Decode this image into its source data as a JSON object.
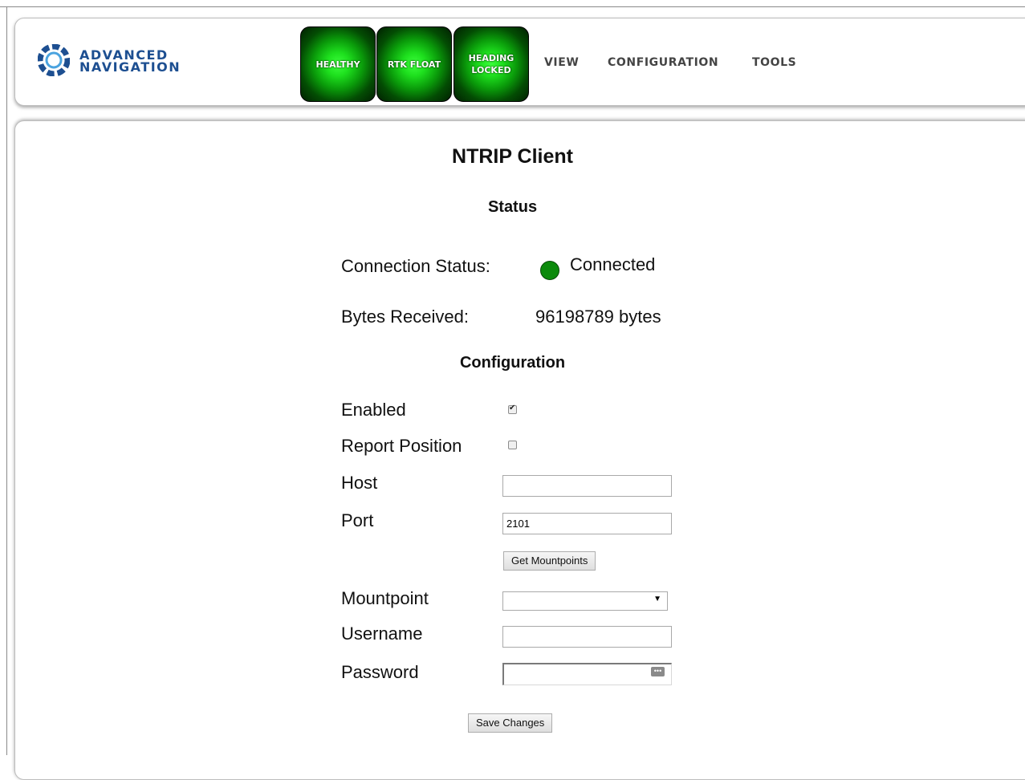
{
  "brand": {
    "line1": "ADVANCED",
    "line2": "NAVIGATION"
  },
  "status_indicators": [
    {
      "line1": "HEALTHY",
      "line2": ""
    },
    {
      "line1": "RTK FLOAT",
      "line2": ""
    },
    {
      "line1": "HEADING",
      "line2": "LOCKED"
    }
  ],
  "menu": [
    "VIEW",
    "CONFIGURATION",
    "TOOLS"
  ],
  "page": {
    "title": "NTRIP Client",
    "status_heading": "Status",
    "config_heading": "Configuration"
  },
  "status": {
    "connection_label": "Connection Status:",
    "connection_value": "Connected",
    "connection_color": "#0c8a0c",
    "bytes_label": "Bytes Received:",
    "bytes_value": "96198789 bytes"
  },
  "config": {
    "enabled_label": "Enabled",
    "enabled_checked": true,
    "report_label": "Report Position",
    "report_checked": false,
    "host_label": "Host",
    "host_value": "",
    "port_label": "Port",
    "port_value": "2101",
    "get_mountpoints_label": "Get Mountpoints",
    "mountpoint_label": "Mountpoint",
    "mountpoint_value": "",
    "username_label": "Username",
    "username_value": "",
    "password_label": "Password",
    "password_value": ""
  },
  "save_label": "Save Changes",
  "colors": {
    "brand": "#1d4f91",
    "indicator_green": "#1ee01e"
  }
}
